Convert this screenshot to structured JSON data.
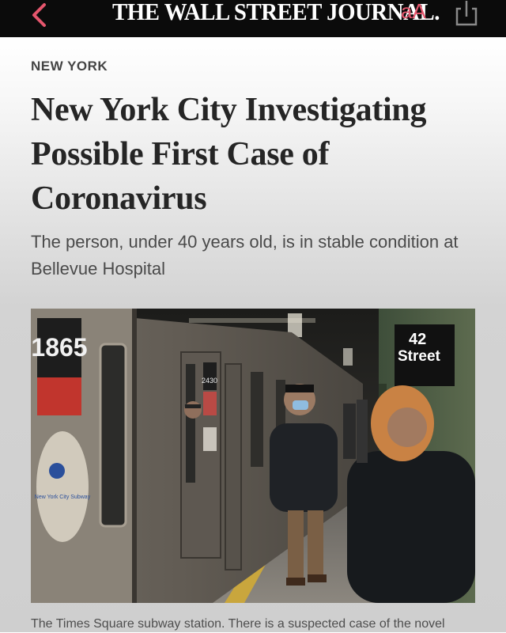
{
  "navbar": {
    "masthead": "THE WALL STREET JOURNAL.",
    "text_size_label": "aA",
    "back_icon": "chevron-left-icon",
    "share_icon": "share-icon",
    "accent_color": "#e5566d"
  },
  "article": {
    "section": "NEW YORK",
    "headline": "New York City Investigating Possible First Case of Coronavirus",
    "dek": "The person, under 40 years old, is in stable condition at Bellevue Hospital",
    "photo": {
      "car_number": "1865",
      "car_number_2": "2430",
      "station_sign_line1": "42",
      "station_sign_line2": "Street",
      "subway_logo_letters": "MTA",
      "subway_logo_text": "New York City Subway"
    },
    "caption": "The Times Square subway station. There is a suspected case of the novel"
  }
}
